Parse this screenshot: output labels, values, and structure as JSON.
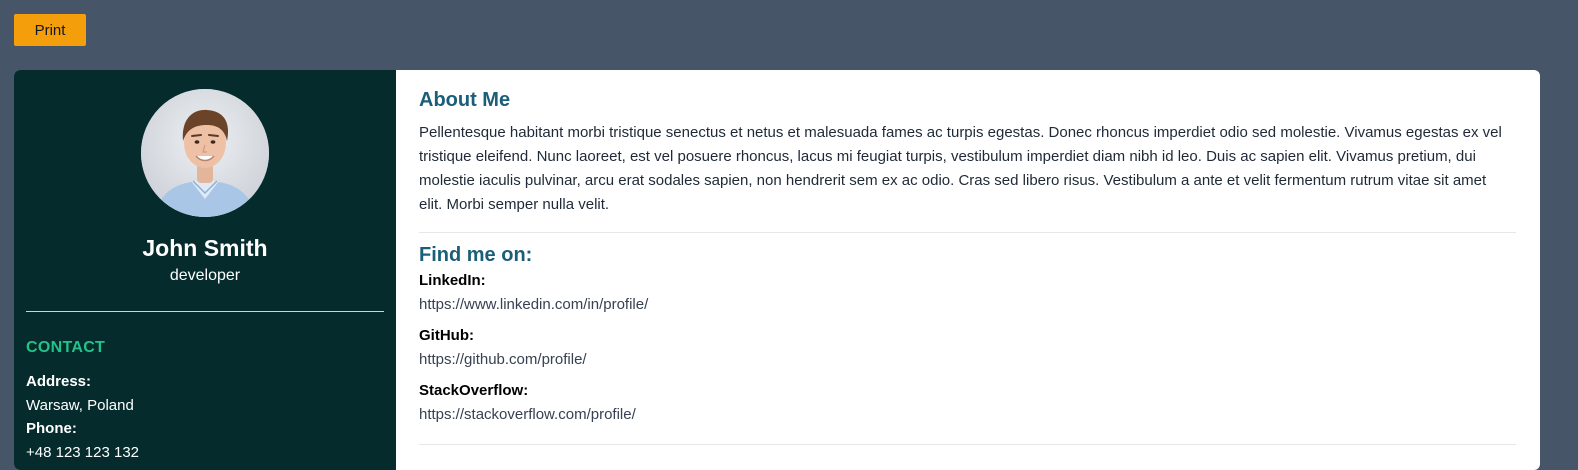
{
  "toolbar": {
    "print_label": "Print"
  },
  "colors": {
    "page_bg": "#475569",
    "sidebar_bg": "#052b2d",
    "accent_button": "#f59e0b",
    "section_title": "#1b5e78",
    "contact_title": "#22c389"
  },
  "profile": {
    "name": "John Smith",
    "role": "developer",
    "avatar_icon": "person-photo-icon"
  },
  "contact": {
    "title": "CONTACT",
    "items": [
      {
        "label": "Address:",
        "value": "Warsaw, Poland"
      },
      {
        "label": "Phone:",
        "value": "+48 123 123 132"
      }
    ]
  },
  "about": {
    "title": "About Me",
    "text": "Pellentesque habitant morbi tristique senectus et netus et malesuada fames ac turpis egestas. Donec rhoncus imperdiet odio sed molestie. Vivamus egestas ex vel tristique eleifend. Nunc laoreet, est vel posuere rhoncus, lacus mi feugiat turpis, vestibulum imperdiet diam nibh id leo. Duis ac sapien elit. Vivamus pretium, dui molestie iaculis pulvinar, arcu erat sodales sapien, non hendrerit sem ex ac odio. Cras sed libero risus. Vestibulum a ante et velit fermentum rutrum vitae sit amet elit. Morbi semper nulla velit."
  },
  "find_me": {
    "title": "Find me on:",
    "links": [
      {
        "label": "LinkedIn:",
        "url": "https://www.linkedin.com/in/profile/"
      },
      {
        "label": "GitHub:",
        "url": "https://github.com/profile/"
      },
      {
        "label": "StackOverflow:",
        "url": "https://stackoverflow.com/profile/"
      }
    ]
  }
}
